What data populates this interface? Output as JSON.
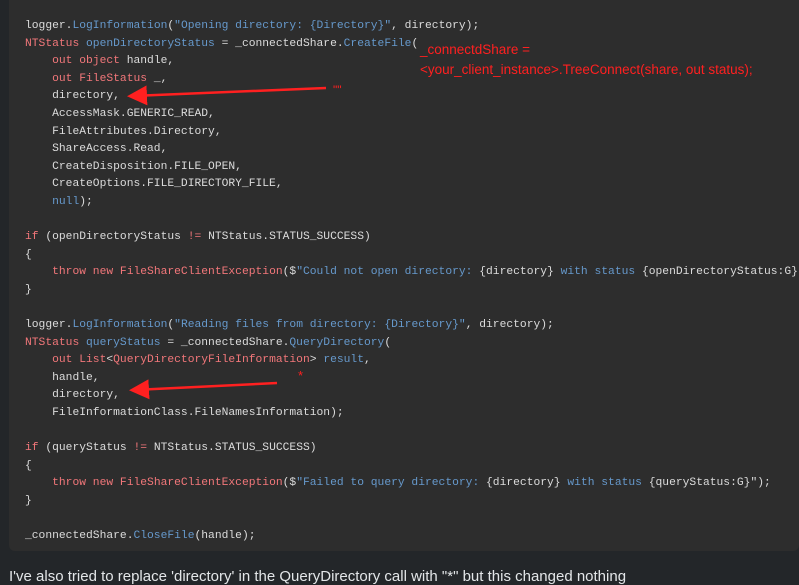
{
  "code_lines": [
    [
      [
        "logger.",
        "default"
      ],
      [
        "LogInformation",
        "blue"
      ],
      [
        "(",
        "default"
      ],
      [
        "\"Opening directory: {Directory}\"",
        "blue"
      ],
      [
        ", directory);",
        "default"
      ]
    ],
    [
      [
        "NTStatus ",
        "red"
      ],
      [
        "openDirectoryStatus",
        "blue"
      ],
      [
        " = _connectedShare.",
        "default"
      ],
      [
        "CreateFile",
        "blue"
      ],
      [
        "(",
        "default"
      ]
    ],
    [
      [
        "    ",
        "default"
      ],
      [
        "out object ",
        "red"
      ],
      [
        "handle,",
        "default"
      ]
    ],
    [
      [
        "    ",
        "default"
      ],
      [
        "out FileStatus ",
        "red"
      ],
      [
        "_,",
        "default"
      ]
    ],
    [
      [
        "    directory,",
        "default"
      ]
    ],
    [
      [
        "    AccessMask.GENERIC_READ,",
        "default"
      ]
    ],
    [
      [
        "    FileAttributes.Directory,",
        "default"
      ]
    ],
    [
      [
        "    ShareAccess.Read,",
        "default"
      ]
    ],
    [
      [
        "    CreateDisposition.FILE_OPEN,",
        "default"
      ]
    ],
    [
      [
        "    CreateOptions.FILE_DIRECTORY_FILE,",
        "default"
      ]
    ],
    [
      [
        "    ",
        "default"
      ],
      [
        "null",
        "blue"
      ],
      [
        ");",
        "default"
      ]
    ],
    [
      [
        "",
        "default"
      ]
    ],
    [
      [
        "if ",
        "red"
      ],
      [
        "(openDirectoryStatus ",
        "default"
      ],
      [
        "!= ",
        "red"
      ],
      [
        "NTStatus.STATUS_SUCCESS)",
        "default"
      ]
    ],
    [
      [
        "{",
        "default"
      ]
    ],
    [
      [
        "    ",
        "default"
      ],
      [
        "throw new ",
        "red"
      ],
      [
        "FileShareClientException",
        "red"
      ],
      [
        "($",
        "default"
      ],
      [
        "\"Could not open directory: ",
        "blue"
      ],
      [
        "{directory}",
        "default"
      ],
      [
        " with status ",
        "blue"
      ],
      [
        "{openDirectoryStatus:G}",
        "default"
      ],
      [
        "\");",
        "default"
      ]
    ],
    [
      [
        "}",
        "default"
      ]
    ],
    [
      [
        "",
        "default"
      ]
    ],
    [
      [
        "logger.",
        "default"
      ],
      [
        "LogInformation",
        "blue"
      ],
      [
        "(",
        "default"
      ],
      [
        "\"Reading files from directory: {Directory}\"",
        "blue"
      ],
      [
        ", directory);",
        "default"
      ]
    ],
    [
      [
        "NTStatus ",
        "red"
      ],
      [
        "queryStatus",
        "blue"
      ],
      [
        " = _connectedShare.",
        "default"
      ],
      [
        "QueryDirectory",
        "blue"
      ],
      [
        "(",
        "default"
      ]
    ],
    [
      [
        "    ",
        "default"
      ],
      [
        "out List",
        "red"
      ],
      [
        "<",
        "default"
      ],
      [
        "QueryDirectoryFileInformation",
        "red"
      ],
      [
        "> ",
        "default"
      ],
      [
        "result",
        "blue"
      ],
      [
        ",",
        "default"
      ]
    ],
    [
      [
        "    handle,",
        "default"
      ]
    ],
    [
      [
        "    directory,",
        "default"
      ]
    ],
    [
      [
        "    FileInformationClass.FileNamesInformation);",
        "default"
      ]
    ],
    [
      [
        "",
        "default"
      ]
    ],
    [
      [
        "if ",
        "red"
      ],
      [
        "(queryStatus ",
        "default"
      ],
      [
        "!= ",
        "red"
      ],
      [
        "NTStatus.STATUS_SUCCESS)",
        "default"
      ]
    ],
    [
      [
        "{",
        "default"
      ]
    ],
    [
      [
        "    ",
        "default"
      ],
      [
        "throw new ",
        "red"
      ],
      [
        "FileShareClientException",
        "red"
      ],
      [
        "($",
        "default"
      ],
      [
        "\"Failed to query directory: ",
        "blue"
      ],
      [
        "{directory}",
        "default"
      ],
      [
        " with status ",
        "blue"
      ],
      [
        "{queryStatus:G}",
        "default"
      ],
      [
        "\");",
        "default"
      ]
    ],
    [
      [
        "}",
        "default"
      ]
    ],
    [
      [
        "",
        "default"
      ]
    ],
    [
      [
        "_connectedShare.",
        "default"
      ],
      [
        "CloseFile",
        "blue"
      ],
      [
        "(handle);",
        "default"
      ]
    ]
  ],
  "annotations": {
    "note_text": "_connectdShare =\n<your_client_instance>.TreeConnect(share, out status);",
    "mark_1": "\"\"",
    "mark_2": "*",
    "color": "#ff2020"
  },
  "post_text": "I've also tried to replace 'directory' in the QueryDirectory call with \"*\" but this changed nothing"
}
